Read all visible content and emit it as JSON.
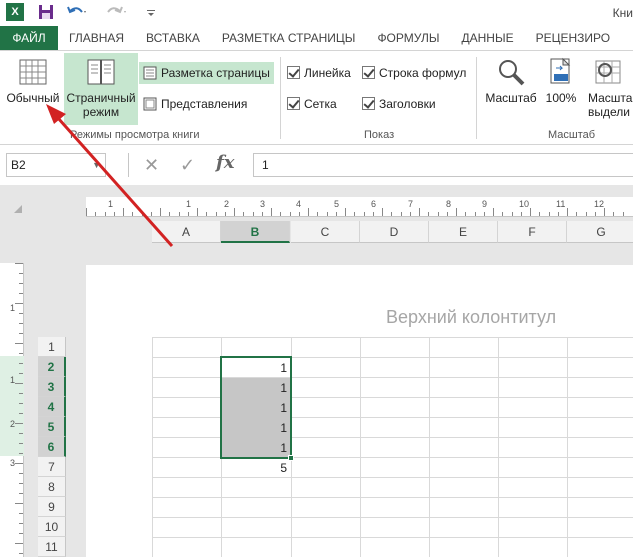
{
  "title": "Кни",
  "tabs": [
    "ФАЙЛ",
    "ГЛАВНАЯ",
    "ВСТАВКА",
    "РАЗМЕТКА СТРАНИЦЫ",
    "ФОРМУЛЫ",
    "ДАННЫЕ",
    "РЕЦЕНЗИРО"
  ],
  "ribbon": {
    "normal": "Обычный",
    "page_break_line1": "Страничный",
    "page_break_line2": "режим",
    "page_layout": "Разметка страницы",
    "custom_views": "Представления",
    "group_views": "Режимы просмотра книги",
    "ruler": "Линейка",
    "formula_bar": "Строка формул",
    "gridlines": "Сетка",
    "headings": "Заголовки",
    "group_show": "Показ",
    "zoom": "Масштаб",
    "zoom100": "100%",
    "zoom_sel_line1": "Масшта",
    "zoom_sel_line2": "выдели",
    "group_zoom": "Масштаб"
  },
  "formula": {
    "namebox": "B2",
    "fx": "fx",
    "value": "1"
  },
  "ruler": {
    "nums": [
      "1",
      "1",
      "2",
      "3",
      "4",
      "5",
      "6",
      "7",
      "8",
      "9",
      "10",
      "11",
      "12"
    ],
    "vnums": [
      "1",
      "1",
      "2",
      "3"
    ]
  },
  "columns": [
    "A",
    "B",
    "C",
    "D",
    "E",
    "F",
    "G"
  ],
  "selected_column": "B",
  "header_placeholder": "Верхний колонтитул",
  "rows": [
    "1",
    "2",
    "3",
    "4",
    "5",
    "6",
    "7",
    "8",
    "9",
    "10",
    "11"
  ],
  "selected_rows": [
    "2",
    "3",
    "4",
    "5",
    "6"
  ],
  "cells_b": [
    "",
    "1",
    "1",
    "1",
    "1",
    "1",
    "5",
    "",
    "",
    "",
    ""
  ],
  "colors": {
    "accent": "#217346",
    "selection": "#c6c6c6",
    "arrow": "#d22222"
  }
}
